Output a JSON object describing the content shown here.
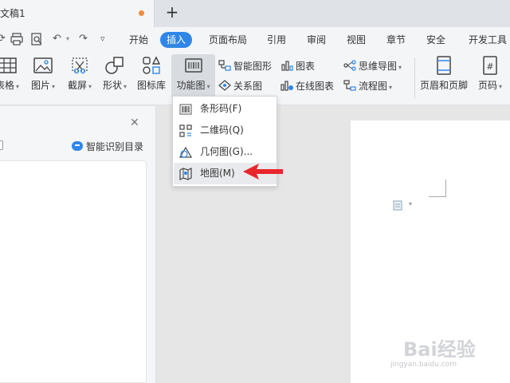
{
  "titlebar": {
    "doc_title": "文稿1",
    "new_tab": "+"
  },
  "menu": {
    "items": [
      "开始",
      "插入",
      "页面布局",
      "引用",
      "审阅",
      "视图",
      "章节",
      "安全",
      "开发工具"
    ],
    "active": "插入"
  },
  "ribbon": {
    "table": "表格",
    "picture": "图片",
    "screenshot": "截屏",
    "shape": "形状",
    "icon_lib": "图标库",
    "func_chart": "功能图",
    "smart_shape": "智能图形",
    "relation": "关系图",
    "chart": "图表",
    "online_chart": "在线图表",
    "mindmap": "思维导图",
    "flowchart": "流程图",
    "header_footer": "页眉和页脚",
    "page_num": "页码"
  },
  "dropdown": {
    "items": [
      "条形码(F)",
      "二维码(Q)",
      "几何图(G)...",
      "地图(M)"
    ]
  },
  "panel": {
    "smart_toc": "智能识别目录"
  },
  "watermark": {
    "brand": "Bai经验",
    "url": "jingyan.baidu.com"
  },
  "colors": {
    "accent": "#2f86e8",
    "arrow": "#e8262c",
    "tab_dot": "#f08c3c"
  }
}
